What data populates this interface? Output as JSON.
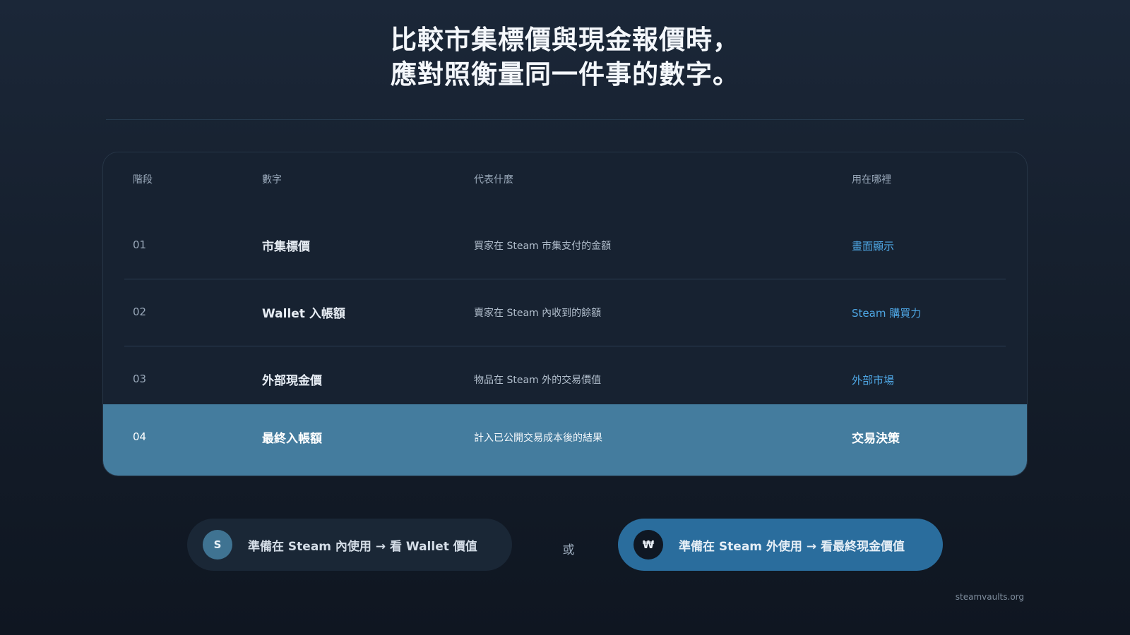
{
  "headline": {
    "line1": "比較市集標價與現金報價時，",
    "line2": "應對照衡量同一件事的數字。"
  },
  "table": {
    "headers": {
      "stage": "階段",
      "number": "數字",
      "meaning": "代表什麼",
      "usage": "用在哪裡"
    },
    "rows": [
      {
        "index": "01",
        "name": "市集標價",
        "meaning": "買家在 Steam 市集支付的金額",
        "usage": "畫面顯示"
      },
      {
        "index": "02",
        "name": "Wallet 入帳額",
        "meaning": "賣家在 Steam 內收到的餘額",
        "usage": "Steam 購買力"
      },
      {
        "index": "03",
        "name": "外部現金價",
        "meaning": "物品在 Steam 外的交易價值",
        "usage": "外部市場"
      },
      {
        "index": "04",
        "name": "最終入帳額",
        "meaning": "計入已公開交易成本後的結果",
        "usage": "交易決策"
      }
    ]
  },
  "choices": {
    "left": {
      "badge": "S",
      "label": "準備在 Steam 內使用 → 看 Wallet 價值"
    },
    "or": "或",
    "right": {
      "badge": "₩",
      "label": "準備在 Steam 外使用 → 看最終現金價值"
    }
  },
  "footer": "steamvaults.org",
  "colors": {
    "accent": "#4fa8e6",
    "highlight_row": "#447c9e",
    "primary_pill": "#2a6d9d"
  }
}
